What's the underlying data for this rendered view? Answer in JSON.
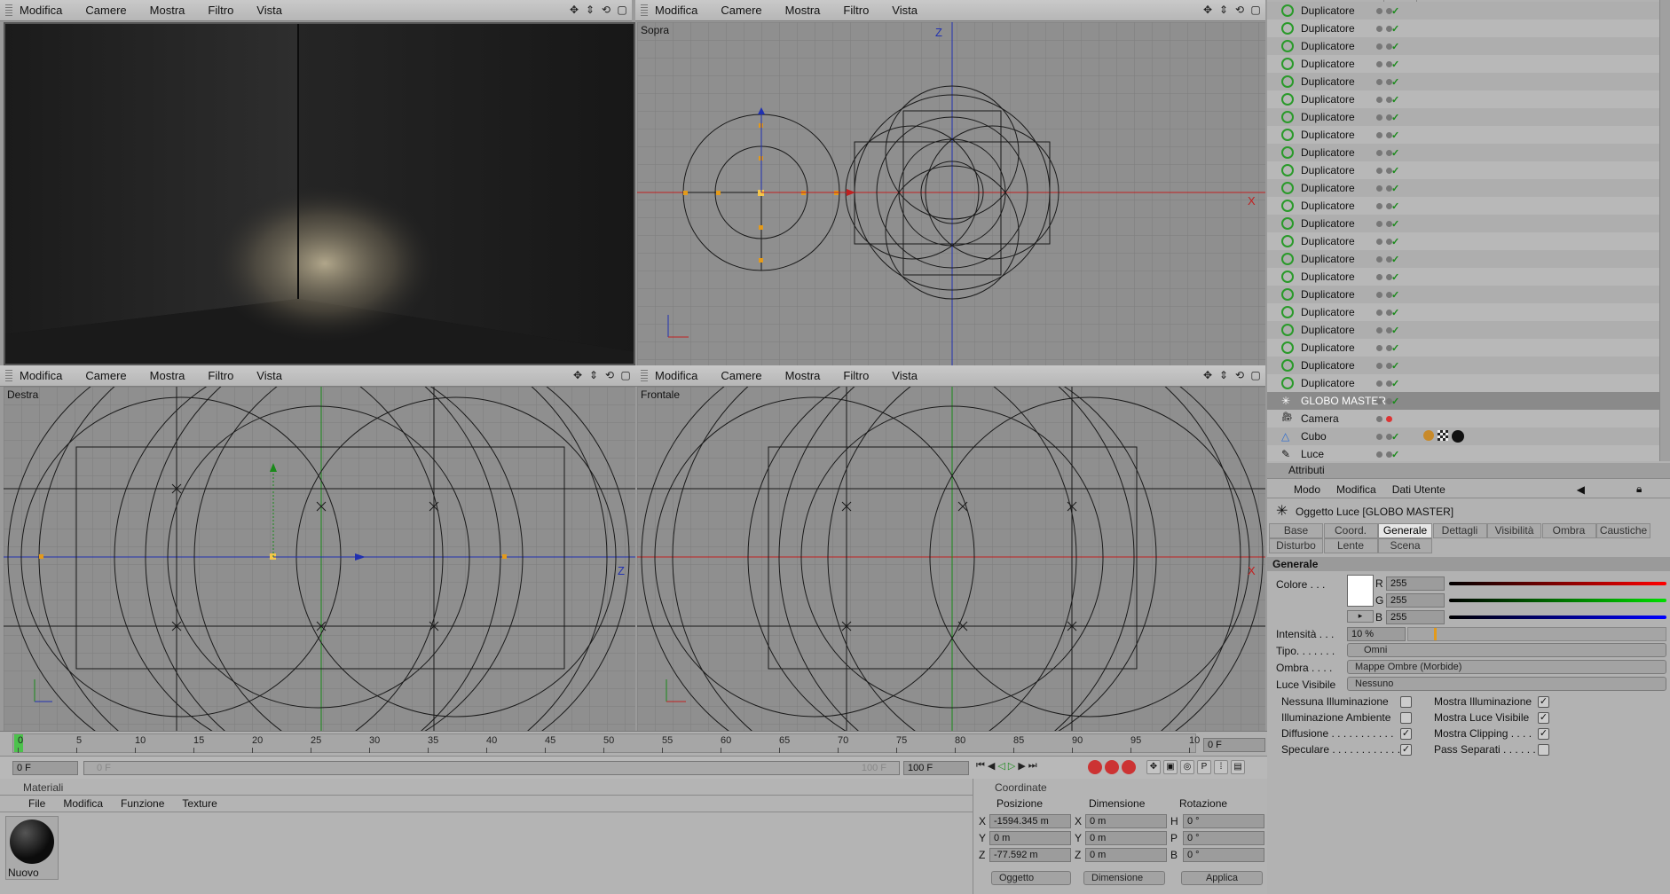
{
  "viewports": {
    "menu": [
      "Modifica",
      "Camere",
      "Mostra",
      "Filtro",
      "Vista"
    ],
    "top_label": "Sopra",
    "right_label": "Destra",
    "front_label": "Frontale",
    "axis_z": "Z",
    "axis_x": "X"
  },
  "objects": {
    "items": [
      "Duplicatore",
      "Duplicatore",
      "Duplicatore",
      "Duplicatore",
      "Duplicatore",
      "Duplicatore",
      "Duplicatore",
      "Duplicatore",
      "Duplicatore",
      "Duplicatore",
      "Duplicatore",
      "Duplicatore",
      "Duplicatore",
      "Duplicatore",
      "Duplicatore",
      "Duplicatore",
      "Duplicatore",
      "Duplicatore",
      "Duplicatore",
      "Duplicatore",
      "Duplicatore",
      "Duplicatore"
    ],
    "globo": "GLOBO MASTER",
    "camera": "Camera",
    "cubo": "Cubo",
    "luce": "Luce"
  },
  "attributes": {
    "title": "Attributi",
    "menu": [
      "Modo",
      "Modifica",
      "Dati Utente"
    ],
    "object_title": "Oggetto Luce [GLOBO MASTER]",
    "tabs_row1": [
      "Base",
      "Coord.",
      "Generale",
      "Dettagli",
      "Visibilità",
      "Ombra",
      "Caustiche"
    ],
    "tabs_row2": [
      "Disturbo",
      "Lente",
      "Scena"
    ],
    "section": "Generale",
    "color_label": "Colore . . .",
    "r_label": "R",
    "g_label": "G",
    "b_label": "B",
    "r": "255",
    "g": "255",
    "b": "255",
    "intensity_label": "Intensità . . .",
    "intensity": "10 %",
    "intensity_fraction": 0.1,
    "type_label": "Tipo. . . . . . .",
    "type_value": "Omni",
    "shadow_label": "Ombra . . . .",
    "shadow_value": "Mappe Ombre (Morbide)",
    "visible_label": "Luce Visibile",
    "visible_value": "Nessuno",
    "checks_left": [
      {
        "label": "Nessuna Illuminazione",
        "checked": false
      },
      {
        "label": "Illuminazione Ambiente",
        "checked": false
      },
      {
        "label": "Diffusione . . . . . . . . . . .",
        "checked": true
      },
      {
        "label": "Speculare . . . . . . . . . . . .",
        "checked": true
      }
    ],
    "checks_right": [
      {
        "label": "Mostra Illuminazione",
        "checked": true
      },
      {
        "label": "Mostra Luce Visibile",
        "checked": true
      },
      {
        "label": "Mostra Clipping . . . .",
        "checked": true
      },
      {
        "label": "Pass Separati . . . . . . .",
        "checked": false
      }
    ]
  },
  "timeline": {
    "ticks": [
      "0",
      "5",
      "10",
      "15",
      "20",
      "25",
      "30",
      "35",
      "40",
      "45",
      "50",
      "55",
      "60",
      "65",
      "70",
      "75",
      "80",
      "85",
      "90",
      "95",
      "10"
    ],
    "current_frame": "0 F",
    "start": "0 F",
    "range_start": "0 F",
    "range_end": "100 F",
    "end": "100 F"
  },
  "materials": {
    "title": "Materiali",
    "menu": [
      "File",
      "Modifica",
      "Funzione",
      "Texture"
    ],
    "item": "Nuovo"
  },
  "coords": {
    "title": "Coordinate",
    "col_pos": "Posizione",
    "col_dim": "Dimensione",
    "col_rot": "Rotazione",
    "labels_pos": [
      "X",
      "Y",
      "Z"
    ],
    "labels_dim": [
      "X",
      "Y",
      "Z"
    ],
    "labels_rot": [
      "H",
      "P",
      "B"
    ],
    "pos": [
      "-1594.345 m",
      "0 m",
      "-77.592 m"
    ],
    "dim": [
      "0 m",
      "0 m",
      "0 m"
    ],
    "rot": [
      "0 °",
      "0 °",
      "0 °"
    ],
    "mode1": "Oggetto",
    "mode2": "Dimensione",
    "apply": "Applica"
  }
}
